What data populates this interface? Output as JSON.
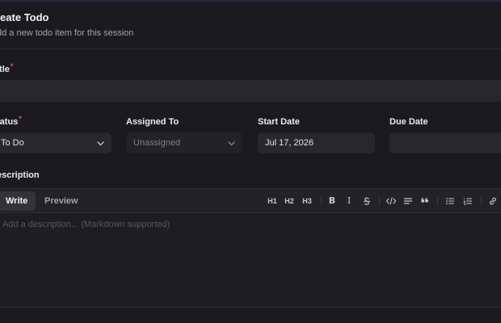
{
  "dialog": {
    "title": "reate Todo",
    "subtitle": "dd a new todo item for this session"
  },
  "form": {
    "title_label": "itle",
    "required_mark": "*",
    "title_value": "",
    "status_label": "tatus",
    "status_value": "To Do",
    "assigned_label": "Assigned To",
    "assigned_value": "Unassigned",
    "start_label": "Start Date",
    "start_value": "Jul 17, 2026",
    "due_label": "Due Date",
    "due_value": "",
    "description_label": "escription"
  },
  "editor": {
    "tabs": [
      {
        "label": "Write",
        "active": true
      },
      {
        "label": "Preview",
        "active": false
      }
    ],
    "tools": {
      "h1": "H1",
      "h2": "H2",
      "h3": "H3",
      "bold": "B",
      "italic": "I"
    },
    "placeholder": "Add a description... (Markdown supported)",
    "icons": [
      "bold-icon",
      "italic-icon",
      "strikethrough-icon",
      "code-icon",
      "align-icon",
      "quote-icon",
      "bullet-list-icon",
      "numbered-list-icon",
      "link-icon"
    ]
  },
  "colors": {
    "background": "#1b1b1e",
    "field": "#28282c",
    "required": "#e05a6b",
    "accent_border": "#2a2640"
  }
}
